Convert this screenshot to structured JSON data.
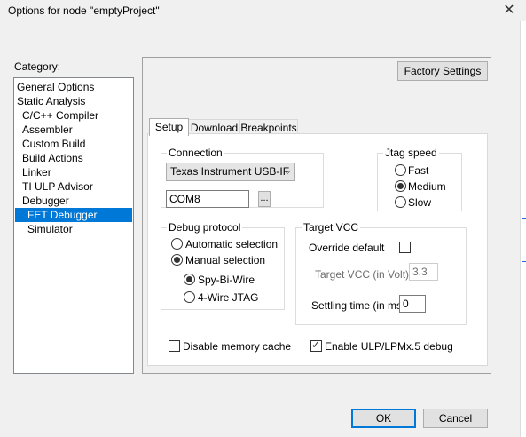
{
  "window": {
    "title": "Options for node \"emptyProject\"",
    "close_glyph": "✕"
  },
  "category": {
    "label": "Category:",
    "items": [
      "General Options",
      "Static Analysis",
      "C/C++ Compiler",
      "Assembler",
      "Custom Build",
      "Build Actions",
      "Linker",
      "TI ULP Advisor",
      "Debugger",
      "FET Debugger",
      "Simulator"
    ],
    "selected": "FET Debugger"
  },
  "panel": {
    "factory_settings": "Factory Settings"
  },
  "tabs": [
    {
      "label": "Setup",
      "active": true
    },
    {
      "label": "Download",
      "active": false
    },
    {
      "label": "Breakpoints",
      "active": false
    }
  ],
  "connection": {
    "title": "Connection",
    "driver": "Texas Instrument USB-IF",
    "port": "COM8",
    "browse": "..."
  },
  "jtag_speed": {
    "title": "Jtag speed",
    "options": [
      "Fast",
      "Medium",
      "Slow"
    ],
    "selected": "Medium"
  },
  "debug_protocol": {
    "title": "Debug protocol",
    "automatic": "Automatic selection",
    "manual": "Manual selection",
    "selected": "Manual selection",
    "spy_bi_wire": "Spy-Bi-Wire",
    "four_wire": "4-Wire JTAG",
    "wire_selected": "Spy-Bi-Wire"
  },
  "target_vcc": {
    "title": "Target VCC",
    "override_label": "Override default",
    "override_checked": false,
    "vcc_label": "Target VCC (in Volt):",
    "vcc_value": "3.3",
    "settling_label": "Settling time (in ms):",
    "settling_value": "0"
  },
  "options": {
    "disable_cache": "Disable memory cache",
    "disable_cache_checked": false,
    "enable_ulp": "Enable ULP/LPMx.5 debug",
    "enable_ulp_checked": true
  },
  "footer": {
    "ok": "OK",
    "cancel": "Cancel"
  },
  "colors": {
    "selection": "#0078d7",
    "default_button_border": "#0078d7"
  }
}
